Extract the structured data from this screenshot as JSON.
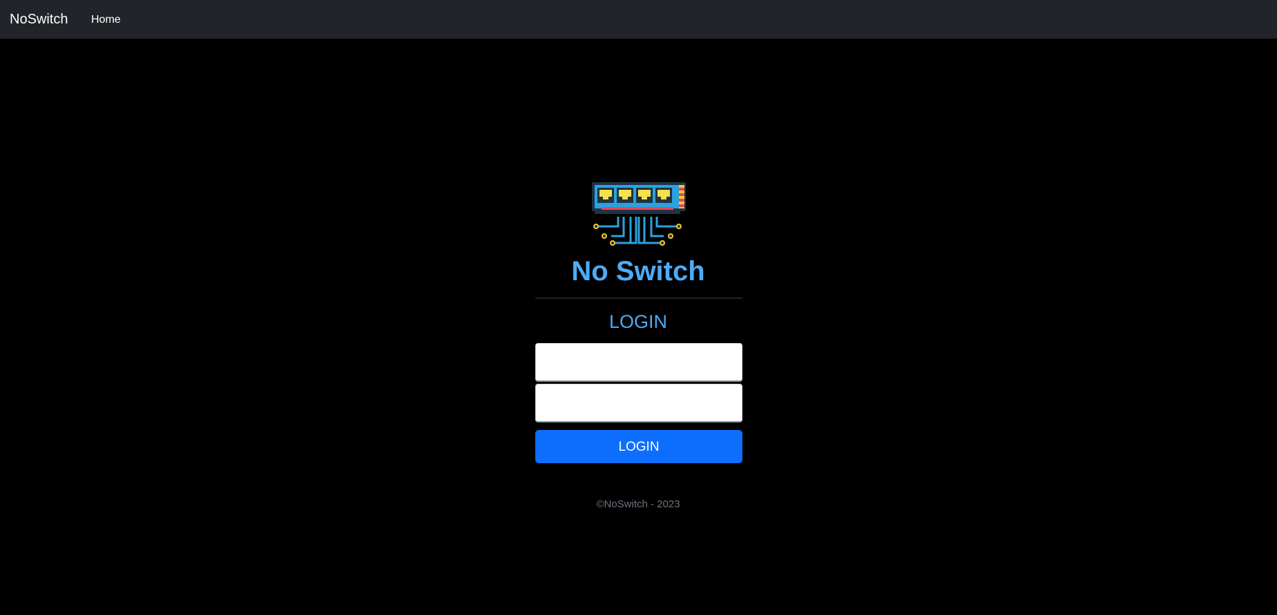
{
  "navbar": {
    "brand": "NoSwitch",
    "links": [
      {
        "label": "Home"
      }
    ]
  },
  "logo": {
    "icon": "network-switch-icon"
  },
  "main": {
    "title": "No Switch",
    "subtitle": "LOGIN",
    "username": {
      "value": "",
      "placeholder": ""
    },
    "password": {
      "value": "",
      "placeholder": ""
    },
    "submit_label": "LOGIN"
  },
  "footer": {
    "text": "©NoSwitch - 2023"
  },
  "colors": {
    "navbar_bg": "#212529",
    "page_bg": "#000000",
    "accent": "#4dabf7",
    "button": "#0d6efd",
    "footer_text": "#6c757d"
  }
}
